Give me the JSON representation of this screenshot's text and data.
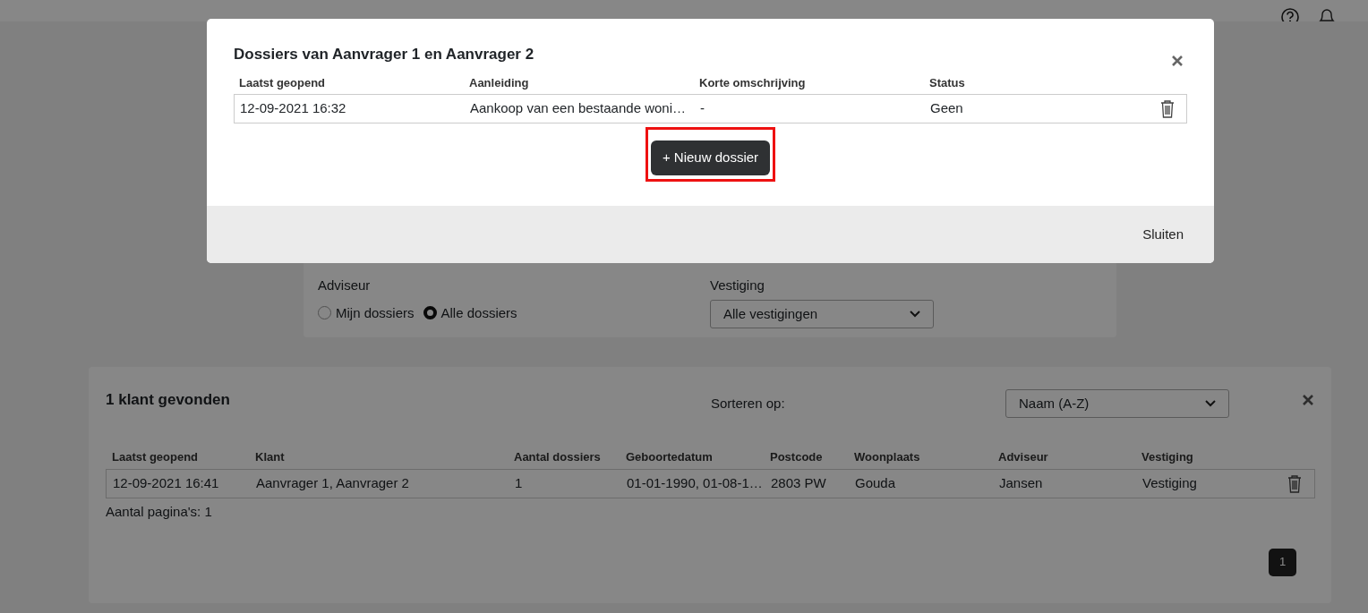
{
  "filters": {
    "adviseur_label": "Adviseur",
    "options": [
      {
        "label": "Mijn dossiers",
        "selected": false
      },
      {
        "label": "Alle dossiers",
        "selected": true
      }
    ],
    "vestiging_label": "Vestiging",
    "vestiging_value": "Alle vestigingen"
  },
  "results": {
    "title": "1 klant gevonden",
    "sort_label": "Sorteren op:",
    "sort_value": "Naam (A-Z)",
    "columns": [
      "Laatst geopend",
      "Klant",
      "Aantal dossiers",
      "Geboortedatum",
      "Postcode",
      "Woonplaats",
      "Adviseur",
      "Vestiging"
    ],
    "rows": [
      {
        "cells": [
          "12-09-2021 16:41",
          "Aanvrager 1, Aanvrager 2",
          "1",
          "01-01-1990, 01-08-1…",
          "2803 PW",
          "Gouda",
          "Jansen",
          "Vestiging"
        ]
      }
    ],
    "page_count": "Aantal pagina's: 1",
    "pages": [
      {
        "label": "1",
        "selected": true
      }
    ]
  },
  "modal": {
    "title": "Dossiers van Aanvrager 1 en Aanvrager 2",
    "columns": [
      "Laatst geopend",
      "Aanleiding",
      "Korte omschrijving",
      "Status"
    ],
    "rows": [
      {
        "cells": [
          "12-09-2021 16:32",
          "Aankoop van een bestaande woni…",
          "-",
          "Geen"
        ]
      }
    ],
    "new_button": "+ Nieuw dossier",
    "highlighted": true,
    "close_button": "Sluiten"
  }
}
